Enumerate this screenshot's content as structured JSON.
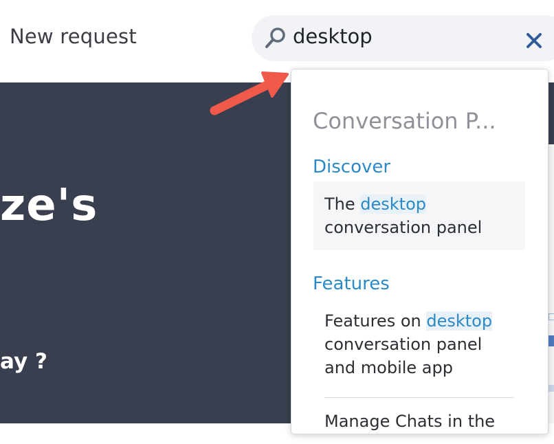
{
  "header": {
    "new_request_label": "New request"
  },
  "search": {
    "value": "desktop"
  },
  "hero": {
    "title_fragment": "ze's",
    "subtitle_fragment": "ay ?"
  },
  "dropdown": {
    "section_title": "Conversation P...",
    "groups": [
      {
        "label": "Discover",
        "items": [
          {
            "before": "The ",
            "highlight": "desktop",
            "after": "conversation panel"
          }
        ]
      },
      {
        "label": "Features",
        "items": [
          {
            "before": "Features on ",
            "highlight": "desktop",
            "after": "conversation panel and mobile app"
          },
          {
            "before": "Manage Chats in the",
            "highlight": "",
            "after": ""
          }
        ]
      }
    ]
  },
  "colors": {
    "accent": "#2b8ac6",
    "hero_bg": "#3a3f4f",
    "arrow": "#f15a4a",
    "clear_icon": "#2f5b9a"
  },
  "icons": [
    "search-icon",
    "close-icon",
    "annotation-arrow"
  ]
}
